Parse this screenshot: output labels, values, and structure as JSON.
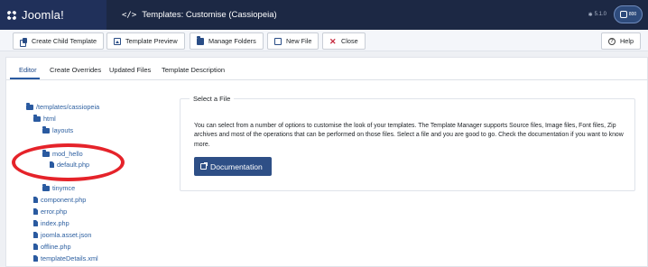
{
  "header": {
    "logo_text": "Joomla!",
    "title": "Templates: Customise (Cassiopeia)",
    "version": "5.1.0",
    "user_label": "800"
  },
  "toolbar": {
    "create_child": "Create Child Template",
    "preview": "Template Preview",
    "manage_folders": "Manage Folders",
    "new_file": "New File",
    "close": "Close",
    "help": "Help"
  },
  "tabs": {
    "editor": "Editor",
    "overrides": "Create Overrides",
    "updated": "Updated Files",
    "description": "Template Description"
  },
  "tree": {
    "root": "/templates/cassiopeia",
    "html": "html",
    "layouts": "layouts",
    "mod_hello": "mod_hello",
    "default_php": "default.php",
    "tinymce": "tinymce",
    "component": "component.php",
    "error": "error.php",
    "index": "index.php",
    "asset": "joomla.asset.json",
    "offline": "offline.php",
    "details": "templateDetails.xml"
  },
  "panel": {
    "legend": "Select a File",
    "text": "You can select from a number of options to customise the look of your templates. The Template Manager supports Source files, Image files, Font files, Zip archives and most of the operations that can be performed on those files. Select a file and you are good to go. Check the documentation if you want to know more.",
    "doc_button": "Documentation"
  },
  "colors": {
    "header_bg": "#1c2844",
    "accent": "#2e4f86",
    "annotation": "#e5232a"
  }
}
